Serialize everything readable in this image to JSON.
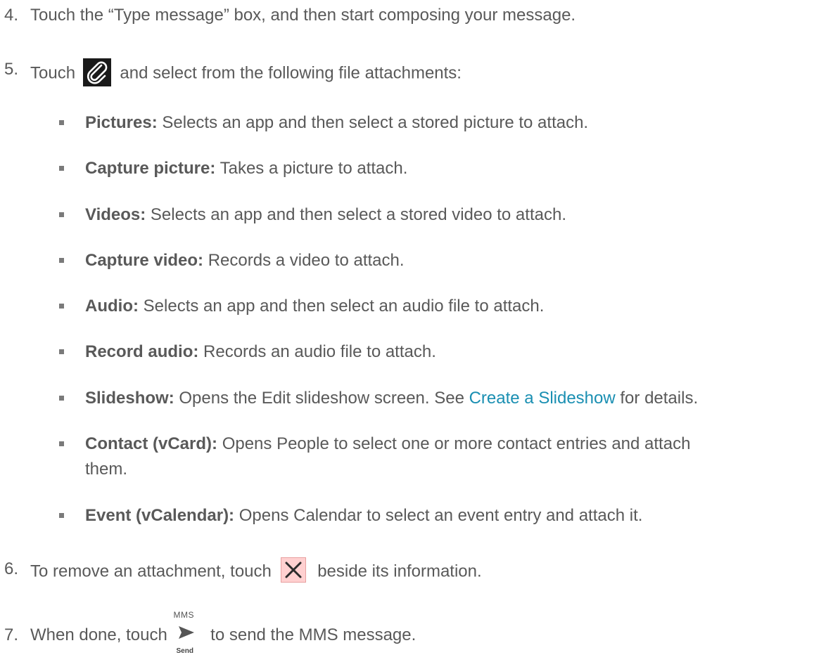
{
  "steps": {
    "s4": {
      "number": "4.",
      "text": "Touch the “Type message” box, and then start composing your message."
    },
    "s5": {
      "number": "5.",
      "prefix": "Touch",
      "suffix": "and select from the following file attachments:",
      "icon": "paperclip-icon"
    },
    "s6": {
      "number": "6.",
      "prefix": "To remove an attachment, touch",
      "suffix": "beside its information.",
      "icon": "close-x-icon"
    },
    "s7": {
      "number": "7.",
      "prefix": "When done, touch",
      "suffix": "to send the MMS message.",
      "icon": "send-icon",
      "icon_top_label": "MMS",
      "icon_bottom_label": "Send"
    }
  },
  "attachments": [
    {
      "term": "Pictures:",
      "desc": "Selects an app and then select a stored picture to attach."
    },
    {
      "term": "Capture picture:",
      "desc": "Takes a picture to attach."
    },
    {
      "term": "Videos:",
      "desc": "Selects an app and then select a stored video to attach."
    },
    {
      "term": "Capture video:",
      "desc": "Records a video to attach."
    },
    {
      "term": "Audio:",
      "desc": "Selects an app and then select an audio file to attach."
    },
    {
      "term": "Record audio:",
      "desc": "Records an audio file to attach."
    },
    {
      "term": "Slideshow:",
      "desc": "Opens the Edit slideshow screen. See",
      "link": "Create a Slideshow",
      "desc_after": "for details."
    },
    {
      "term": "Contact (vCard):",
      "desc": "Opens People to select one or more contact entries and attach",
      "desc_line2": "them."
    },
    {
      "term": "Event (vCalendar):",
      "desc": "Opens Calendar to select an event entry and attach it."
    }
  ],
  "colors": {
    "text": "#595959",
    "link": "#1a8fb2",
    "bullet": "#7a7a7a",
    "x_icon_bg": "#ffd0d0"
  }
}
